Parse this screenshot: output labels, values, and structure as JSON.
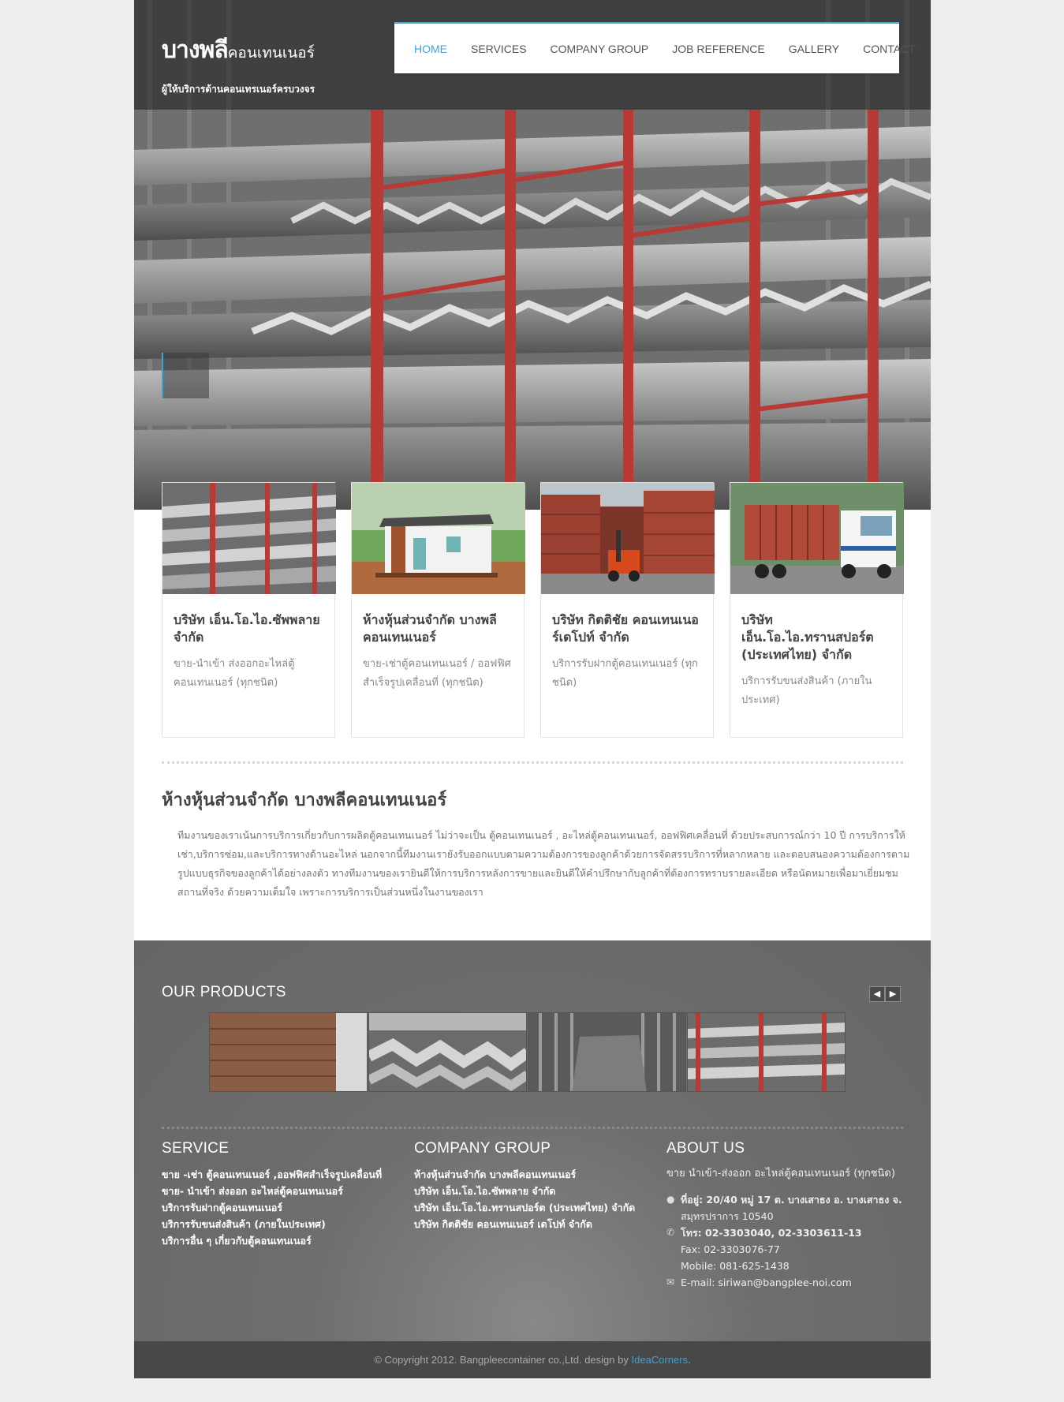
{
  "header": {
    "logo_main": "บางพลี",
    "logo_sub": "คอนเทนเนอร์",
    "tagline": "ผู้ให้บริการด้านคอนเทรเนอร์ครบวงจร"
  },
  "nav": {
    "items": [
      {
        "label": "HOME",
        "active": true
      },
      {
        "label": "SERVICES"
      },
      {
        "label": "COMPANY GROUP"
      },
      {
        "label": "JOB REFERENCE"
      },
      {
        "label": "GALLERY"
      },
      {
        "label": "CONTACT"
      }
    ]
  },
  "cards": [
    {
      "title": "บริษัท เอ็น.โอ.ไอ.ซัพพลาย จำกัด",
      "desc": "ขาย-นำเข้า ส่งออกอะไหล่ตู้คอนเทนเนอร์ (ทุกชนิด)",
      "image": "steel-rack"
    },
    {
      "title": "ห้างหุ้นส่วนจำกัด บางพลีคอนเทนเนอร์",
      "desc": "ขาย-เช่าตู้คอนเทนเนอร์ / ออฟฟิศสำเร็จรูปเคลื่อนที่ (ทุกชนิด)",
      "image": "container-office"
    },
    {
      "title": "บริษัท กิตติชัย คอนเทนเนอร์เดโปท์ จำกัด",
      "desc": "บริการรับฝากตู้คอนเทนเนอร์ (ทุกชนิด)",
      "image": "container-yard"
    },
    {
      "title": "บริษัท เอ็น.โอ.ไอ.ทรานสปอร์ต (ประเทศไทย) จำกัด",
      "desc": "บริการรับขนส่งสินค้า (ภายในประเทศ)",
      "image": "truck"
    }
  ],
  "about": {
    "title": "ห้างหุ้นส่วนจำกัด บางพลีคอนเทนเนอร์",
    "body": "ทีมงานของเราเน้นการบริการเกี่ยวกับการผลิตตู้คอนเทนเนอร์ ไม่ว่าจะเป็น ตู้คอนเทนเนอร์ , อะไหล่ตู้คอนเทนเนอร์, ออฟฟิศเคลื่อนที่ ด้วยประสบการณ์กว่า 10 ปี การบริการให้เช่า,บริการซ่อม,และบริการทางด้านอะไหล่ นอกจากนี้ทีมงานเรายังรับออกแบบตามความต้องการของลูกค้าด้วยการจัดสรรบริการที่หลากหลาย และตอบสนองความต้องการตามรูปแบบธุรกิจของลูกค้าได้อย่างลงตัว ทางทีมงานของเรายินดีให้การบริการหลังการขายและยินดีให้คำปรึกษากับลูกค้าที่ต้องการทราบรายละเอียด หรือนัดหมายเพื่อมาเยี่ยมชมสถานที่จริง ด้วยความเต็มใจ เพราะการบริการเป็นส่วนหนึ่งในงานของเรา"
  },
  "products": {
    "title": "OUR PRODUCTS",
    "prev_icon": "chevron-left-icon",
    "next_icon": "chevron-right-icon",
    "items": [
      "plywood-floor",
      "angle-steel",
      "corrugated-panel",
      "steel-rack"
    ]
  },
  "service": {
    "title": "SERVICE",
    "items": [
      "ขาย -เช่า ตู้คอนเทนเนอร์ ,ออฟฟิศสำเร็จรูปเคลื่อนที่",
      "ขาย- นำเข้า ส่งออก อะไหล่ตู้คอนเทนเนอร์",
      "บริการรับฝากตู้คอนเทนเนอร์",
      "บริการรับขนส่งสินค้า (ภายในประเทศ)",
      "บริการอื่น ๆ เกี่ยวกับตู้คอนเทนเนอร์"
    ]
  },
  "company_group": {
    "title": "COMPANY GROUP",
    "items": [
      "ห้างหุ้นส่วนจำกัด บางพลีคอนเทนเนอร์",
      "บริษัท เอ็น.โอ.ไอ.ซัพพลาย จำกัด",
      "บริษัท เอ็น.โอ.ไอ.ทรานสปอร์ต (ประเทศไทย) จำกัด",
      "บริษัท กิตติชัย คอนเทนเนอร์ เดโปท์ จำกัด"
    ]
  },
  "about_us": {
    "title": "ABOUT US",
    "subtitle": "ขาย นำเข้า-ส่งออก อะไหล่ตู้คอนเทนเนอร์ (ทุกชนิด)",
    "address_line1": "ที่อยู่: 20/40 หมู่ 17 ต. บางเสาธง อ. บางเสาธง จ.",
    "address_line2": "สมุทรปราการ 10540",
    "phone": "โทร: 02-3303040, 02-3303611-13",
    "fax": "Fax: 02-3303076-77",
    "mobile": "Mobile: 081-625-1438",
    "email": "E-mail: siriwan@bangplee-noi.com",
    "icons": [
      "globe-icon",
      "phone-icon",
      "envelope-icon"
    ]
  },
  "footer": {
    "copyright": "© Copyright 2012. Bangpleecontainer co.,Ltd. design by",
    "designer": "IdeaCorners",
    "period": "."
  },
  "colors": {
    "accent": "#3ea2d4",
    "dark_bg": "#6e6e6e",
    "footer_bg": "#484848"
  }
}
